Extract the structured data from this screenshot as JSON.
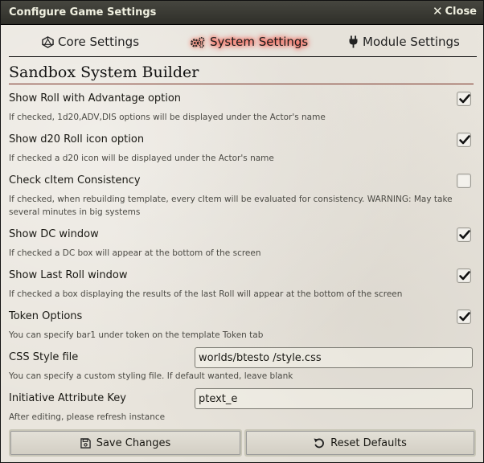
{
  "window": {
    "title": "Configure Game Settings",
    "close_label": "Close",
    "close_icon": "close-icon"
  },
  "tabs": [
    {
      "label": "Core Settings",
      "icon": "d20-icon",
      "active": false
    },
    {
      "label": "System Settings",
      "icon": "gears-icon",
      "active": true
    },
    {
      "label": "Module Settings",
      "icon": "plug-icon",
      "active": false
    }
  ],
  "section": {
    "title": "Sandbox System Builder"
  },
  "settings": [
    {
      "label": "Show Roll with Advantage option",
      "hint": "If checked, 1d20,ADV,DIS options will be displayed under the Actor's name",
      "type": "checkbox",
      "checked": true
    },
    {
      "label": "Show d20 Roll icon option",
      "hint": "If checked a d20 icon will be displayed under the Actor's name",
      "type": "checkbox",
      "checked": true
    },
    {
      "label": "Check cItem Consistency",
      "hint": "If checked, when rebuilding template, every cItem will be evaluated for consistency. WARNING: May take several minutes in big systems",
      "type": "checkbox",
      "checked": false
    },
    {
      "label": "Show DC window",
      "hint": "If checked a DC box will appear at the bottom of the screen",
      "type": "checkbox",
      "checked": true
    },
    {
      "label": "Show Last Roll window",
      "hint": "If checked a box displaying the results of the last Roll will appear at the bottom of the screen",
      "type": "checkbox",
      "checked": true
    },
    {
      "label": "Token Options",
      "hint": "You can specify bar1 under token on the template Token tab",
      "type": "checkbox",
      "checked": true
    },
    {
      "label": "CSS Style file",
      "hint": "You can specify a custom styling file. If default wanted, leave blank",
      "type": "text",
      "value": "worlds/btesto /style.css"
    },
    {
      "label": "Initiative Attribute Key",
      "hint": "After editing, please refresh instance",
      "type": "text",
      "value": "ptext_e"
    }
  ],
  "footer": {
    "save_label": "Save Changes",
    "save_icon": "save-icon",
    "reset_label": "Reset Defaults",
    "reset_icon": "undo-icon"
  },
  "colors": {
    "titlebar": "#3a3a33",
    "section_underline": "#782e22",
    "active_tab_glow": "#ff0000"
  }
}
